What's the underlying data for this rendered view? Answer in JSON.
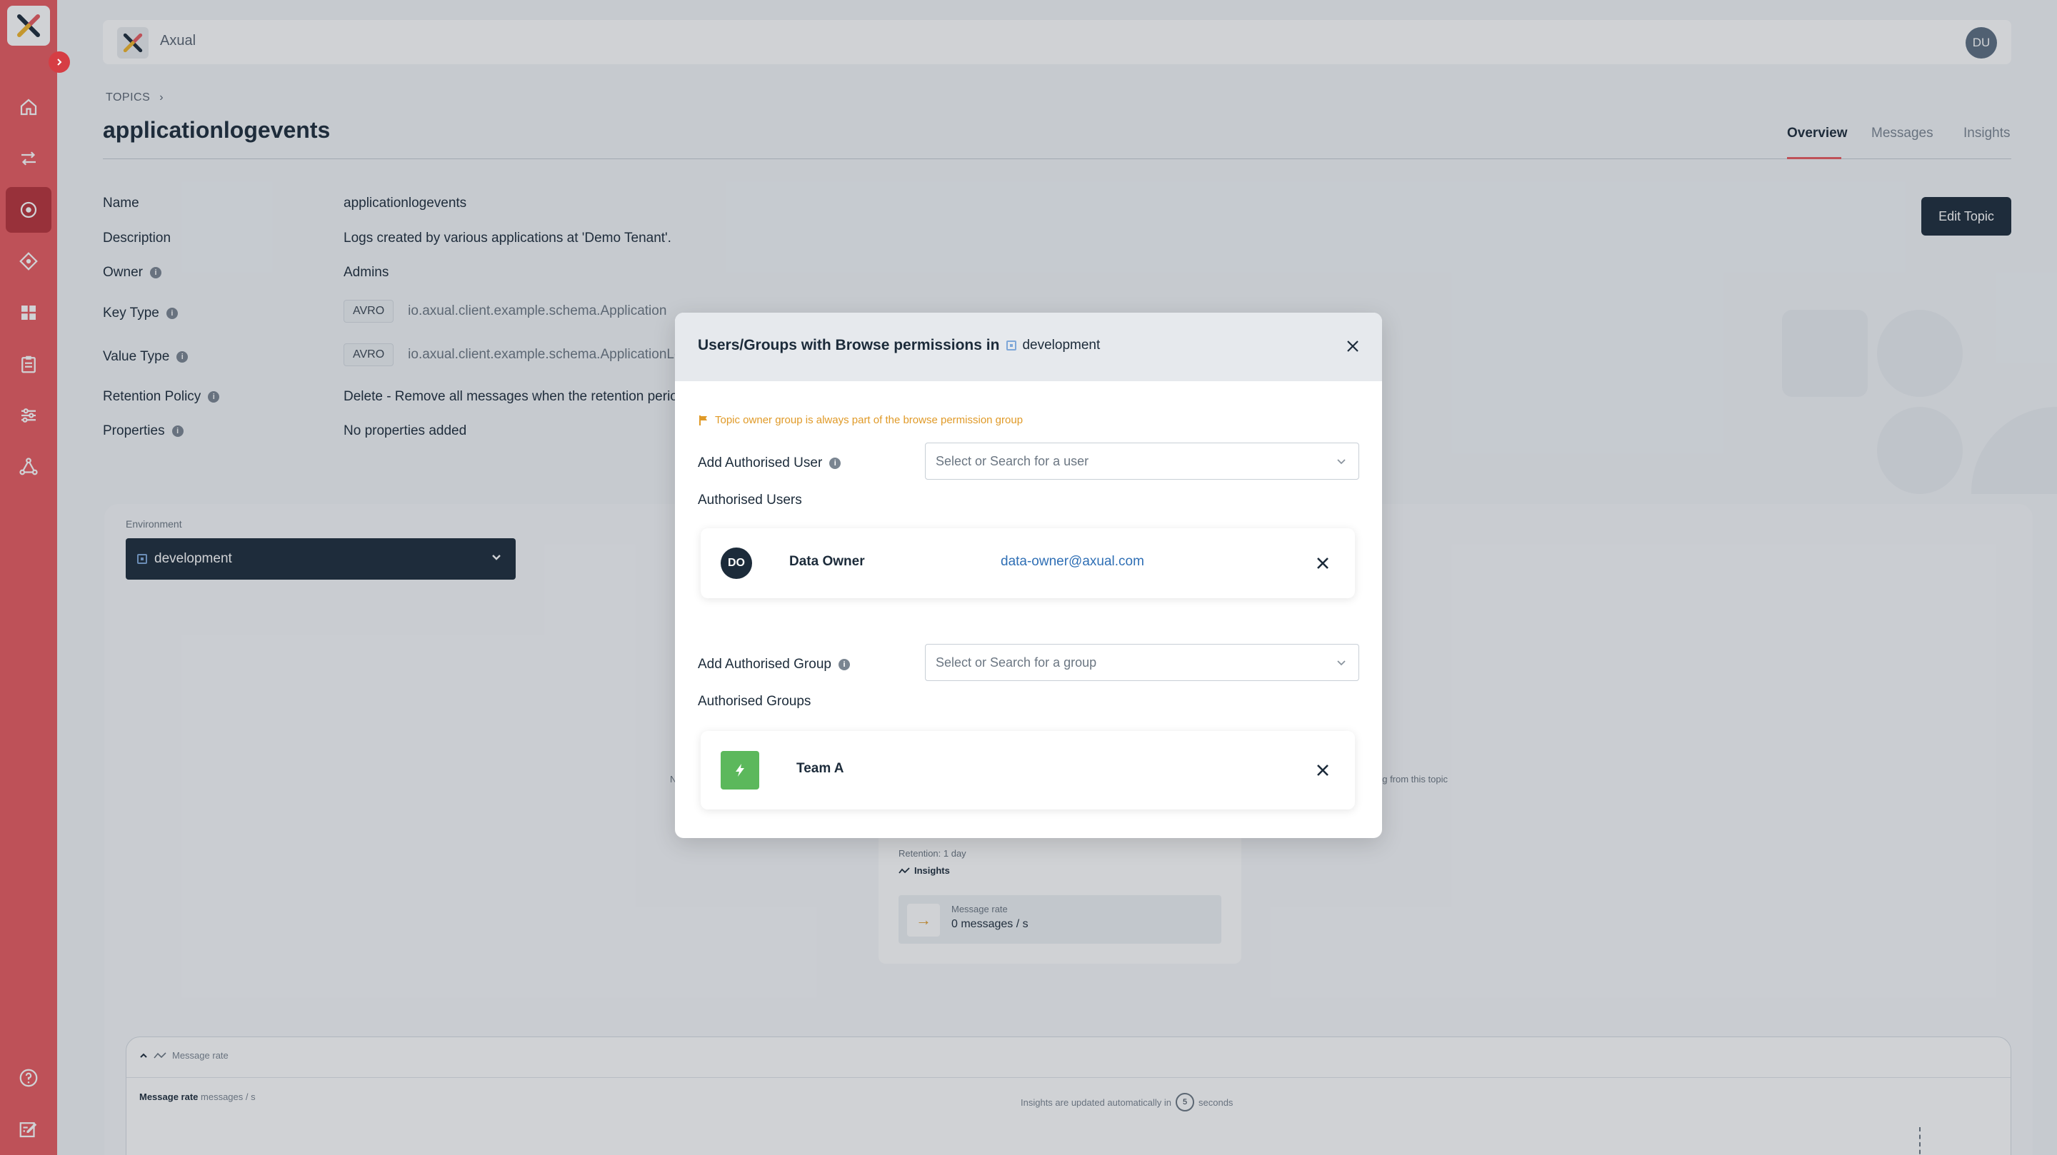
{
  "app": {
    "name": "Axual",
    "user_initials": "DU"
  },
  "breadcrumb": {
    "label": "TOPICS",
    "separator": "›"
  },
  "page": {
    "title": "applicationlogevents"
  },
  "tabs": [
    {
      "label": "Overview",
      "active": true
    },
    {
      "label": "Messages",
      "active": false
    },
    {
      "label": "Insights",
      "active": false
    }
  ],
  "properties": {
    "name_label": "Name",
    "name_value": "applicationlogevents",
    "description_label": "Description",
    "description_value": "Logs created by various applications at 'Demo Tenant'.",
    "owner_label": "Owner",
    "owner_value": "Admins",
    "key_type_label": "Key Type",
    "key_type_tag": "AVRO",
    "key_type_schema": "io.axual.client.example.schema.Application",
    "value_type_label": "Value Type",
    "value_type_tag": "AVRO",
    "value_type_schema": "io.axual.client.example.schema.ApplicationLo",
    "retention_label": "Retention Policy",
    "retention_value": "Delete - Remove all messages when the retention period",
    "properties_label": "Properties",
    "properties_value": "No properties added"
  },
  "edit_topic_label": "Edit Topic",
  "environment": {
    "label": "Environment",
    "selected": "development"
  },
  "background_notes": {
    "left": "N",
    "right": "ng from this topic"
  },
  "env_card": {
    "retention": "Retention: 1 day",
    "insights": "Insights",
    "rate_label": "Message rate",
    "rate_value": "0 messages / s"
  },
  "rate_panel": {
    "header": "Message rate",
    "sub_title": "Message rate",
    "sub_unit": "messages / s",
    "auto_prefix": "Insights are updated automatically in",
    "auto_seconds": "5",
    "auto_suffix": "seconds"
  },
  "modal": {
    "title": "Users/Groups with Browse permissions in",
    "environment": "development",
    "warning": "Topic owner group is always part of the browse permission group",
    "add_user_label": "Add Authorised User",
    "user_placeholder": "Select or Search for a user",
    "authorised_users_label": "Authorised Users",
    "users": [
      {
        "initials": "DO",
        "name": "Data Owner",
        "email": "data-owner@axual.com"
      }
    ],
    "add_group_label": "Add Authorised Group",
    "group_placeholder": "Select or Search for a group",
    "authorised_groups_label": "Authorised Groups",
    "groups": [
      {
        "name": "Team A"
      }
    ]
  },
  "colors": {
    "sidebar": "#e85a5f",
    "primary_dark": "#1c2b3a",
    "link": "#2f6fb5",
    "warning": "#e09a28",
    "group_icon": "#5cb85c"
  }
}
